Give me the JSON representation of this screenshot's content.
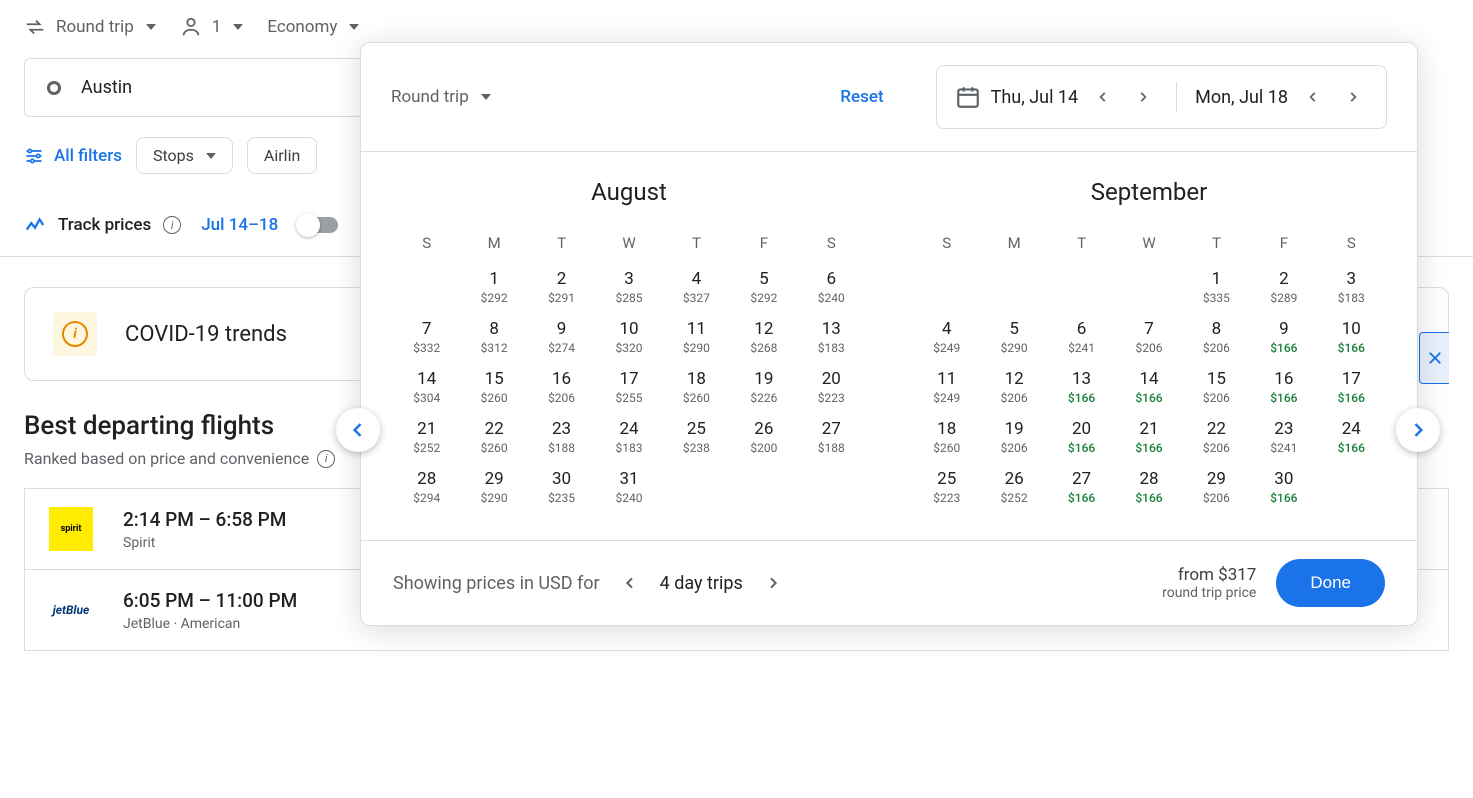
{
  "topbar": {
    "trip_type": "Round trip",
    "passengers": "1",
    "cabin": "Economy"
  },
  "origin": "Austin",
  "filters": {
    "all_label": "All filters",
    "stops_label": "Stops",
    "airlines_label": "Airlin"
  },
  "track": {
    "label": "Track prices",
    "range": "Jul 14–18"
  },
  "covid_label": "COVID-19 trends",
  "best": {
    "title": "Best departing flights",
    "sub": "Ranked based on price and convenience"
  },
  "flights": [
    {
      "times": "2:14 PM – 6:58 PM",
      "carrier": "Spirit",
      "logo": "spirit",
      "logo_text": "spirit"
    },
    {
      "times": "6:05 PM – 11:00 PM",
      "carrier": "JetBlue · American",
      "logo": "jetblue",
      "logo_text": "jetBlue"
    }
  ],
  "overlay": {
    "trip_type": "Round trip",
    "reset": "Reset",
    "depart": "Thu, Jul 14",
    "return": "Mon, Jul 18",
    "bottom": {
      "showing_prefix": "Showing prices in USD for",
      "duration": "4 day trips",
      "from": "from $317",
      "sub": "round trip price",
      "done": "Done"
    },
    "day_heads": [
      "S",
      "M",
      "T",
      "W",
      "T",
      "F",
      "S"
    ],
    "months": [
      {
        "name": "August",
        "offset": 1,
        "days": [
          {
            "n": 1,
            "p": "$292"
          },
          {
            "n": 2,
            "p": "$291"
          },
          {
            "n": 3,
            "p": "$285"
          },
          {
            "n": 4,
            "p": "$327"
          },
          {
            "n": 5,
            "p": "$292"
          },
          {
            "n": 6,
            "p": "$240"
          },
          {
            "n": 7,
            "p": "$332"
          },
          {
            "n": 8,
            "p": "$312"
          },
          {
            "n": 9,
            "p": "$274"
          },
          {
            "n": 10,
            "p": "$320"
          },
          {
            "n": 11,
            "p": "$290"
          },
          {
            "n": 12,
            "p": "$268"
          },
          {
            "n": 13,
            "p": "$183"
          },
          {
            "n": 14,
            "p": "$304"
          },
          {
            "n": 15,
            "p": "$260"
          },
          {
            "n": 16,
            "p": "$206"
          },
          {
            "n": 17,
            "p": "$255"
          },
          {
            "n": 18,
            "p": "$260"
          },
          {
            "n": 19,
            "p": "$226"
          },
          {
            "n": 20,
            "p": "$223"
          },
          {
            "n": 21,
            "p": "$252"
          },
          {
            "n": 22,
            "p": "$260"
          },
          {
            "n": 23,
            "p": "$188"
          },
          {
            "n": 24,
            "p": "$183"
          },
          {
            "n": 25,
            "p": "$238"
          },
          {
            "n": 26,
            "p": "$200"
          },
          {
            "n": 27,
            "p": "$188"
          },
          {
            "n": 28,
            "p": "$294"
          },
          {
            "n": 29,
            "p": "$290"
          },
          {
            "n": 30,
            "p": "$235"
          },
          {
            "n": 31,
            "p": "$240"
          }
        ]
      },
      {
        "name": "September",
        "offset": 4,
        "days": [
          {
            "n": 1,
            "p": "$335"
          },
          {
            "n": 2,
            "p": "$289"
          },
          {
            "n": 3,
            "p": "$183"
          },
          {
            "n": 4,
            "p": "$249"
          },
          {
            "n": 5,
            "p": "$290"
          },
          {
            "n": 6,
            "p": "$241"
          },
          {
            "n": 7,
            "p": "$206"
          },
          {
            "n": 8,
            "p": "$206"
          },
          {
            "n": 9,
            "p": "$166",
            "g": true
          },
          {
            "n": 10,
            "p": "$166",
            "g": true
          },
          {
            "n": 11,
            "p": "$249"
          },
          {
            "n": 12,
            "p": "$206"
          },
          {
            "n": 13,
            "p": "$166",
            "g": true
          },
          {
            "n": 14,
            "p": "$166",
            "g": true
          },
          {
            "n": 15,
            "p": "$206"
          },
          {
            "n": 16,
            "p": "$166",
            "g": true
          },
          {
            "n": 17,
            "p": "$166",
            "g": true
          },
          {
            "n": 18,
            "p": "$260"
          },
          {
            "n": 19,
            "p": "$206"
          },
          {
            "n": 20,
            "p": "$166",
            "g": true
          },
          {
            "n": 21,
            "p": "$166",
            "g": true
          },
          {
            "n": 22,
            "p": "$206"
          },
          {
            "n": 23,
            "p": "$241"
          },
          {
            "n": 24,
            "p": "$166",
            "g": true
          },
          {
            "n": 25,
            "p": "$223"
          },
          {
            "n": 26,
            "p": "$252"
          },
          {
            "n": 27,
            "p": "$166",
            "g": true
          },
          {
            "n": 28,
            "p": "$166",
            "g": true
          },
          {
            "n": 29,
            "p": "$206"
          },
          {
            "n": 30,
            "p": "$166",
            "g": true
          }
        ]
      }
    ]
  }
}
